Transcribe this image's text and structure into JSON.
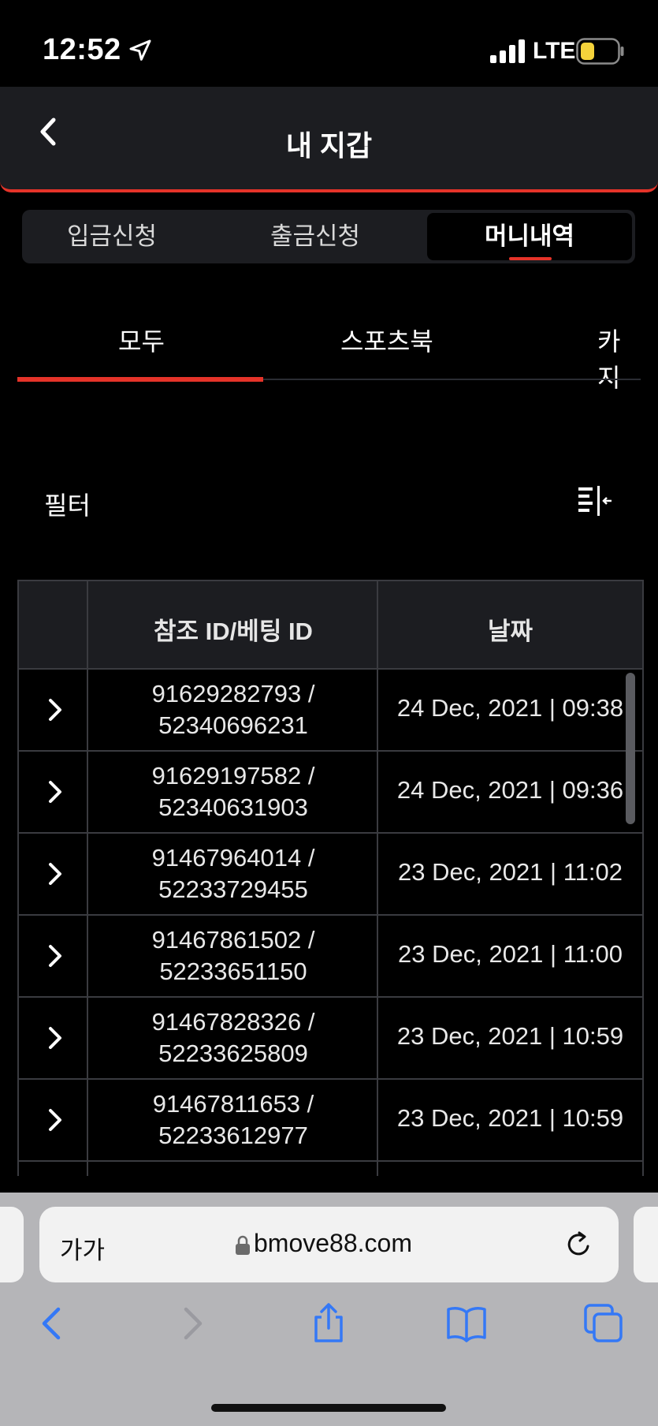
{
  "status_bar": {
    "time": "12:52",
    "network": "LTE",
    "battery_color": "#f5d33b"
  },
  "header": {
    "title": "내 지갑"
  },
  "tabs": [
    {
      "label": "입금신청",
      "active": false
    },
    {
      "label": "출금신청",
      "active": false
    },
    {
      "label": "머니내역",
      "active": true
    }
  ],
  "categories": [
    {
      "label": "모두",
      "active": true
    },
    {
      "label": "스포츠북",
      "active": false
    },
    {
      "label": "카지"
    }
  ],
  "filter": {
    "label": "필터"
  },
  "table": {
    "headers": [
      "참조 ID/베팅 ID",
      "날짜"
    ],
    "rows": [
      {
        "ref_line1": "91629282793 /",
        "ref_line2": "52340696231",
        "date": "24 Dec, 2021 | 09:38"
      },
      {
        "ref_line1": "91629197582 /",
        "ref_line2": "52340631903",
        "date": "24 Dec, 2021 | 09:36"
      },
      {
        "ref_line1": "91467964014 /",
        "ref_line2": "52233729455",
        "date": "23 Dec, 2021 | 11:02"
      },
      {
        "ref_line1": "91467861502 /",
        "ref_line2": "52233651150",
        "date": "23 Dec, 2021 | 11:00"
      },
      {
        "ref_line1": "91467828326 /",
        "ref_line2": "52233625809",
        "date": "23 Dec, 2021 | 10:59"
      },
      {
        "ref_line1": "91467811653 /",
        "ref_line2": "52233612977",
        "date": "23 Dec, 2021 | 10:59"
      }
    ]
  },
  "browser": {
    "text_size": "가가",
    "url": "bmove88.com"
  },
  "colors": {
    "accent": "#e53329",
    "panel": "#1c1d21",
    "ios_blue": "#3478f6"
  }
}
